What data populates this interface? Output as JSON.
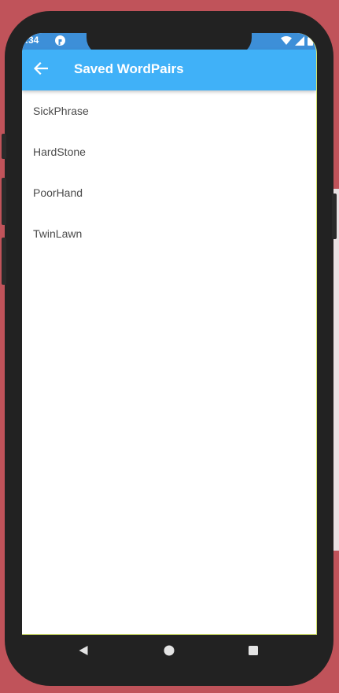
{
  "status_bar": {
    "time": ":34",
    "app_icon": "app-notification-icon",
    "wifi_icon": "wifi-icon",
    "signal_icon": "cell-signal-icon"
  },
  "app_bar": {
    "back_icon": "arrow-back-icon",
    "title": "Saved WordPairs",
    "color": "#40b1f8"
  },
  "saved_list": {
    "items": [
      {
        "label": "SickPhrase"
      },
      {
        "label": "HardStone"
      },
      {
        "label": "PoorHand"
      },
      {
        "label": "TwinLawn"
      }
    ]
  },
  "nav_bar": {
    "back_icon": "triangle-back-icon",
    "home_icon": "circle-home-icon",
    "recents_icon": "square-recents-icon"
  },
  "colors": {
    "status_bar": "#3d8fd8",
    "text": "#4a4a4a",
    "background": "#c0535a"
  }
}
